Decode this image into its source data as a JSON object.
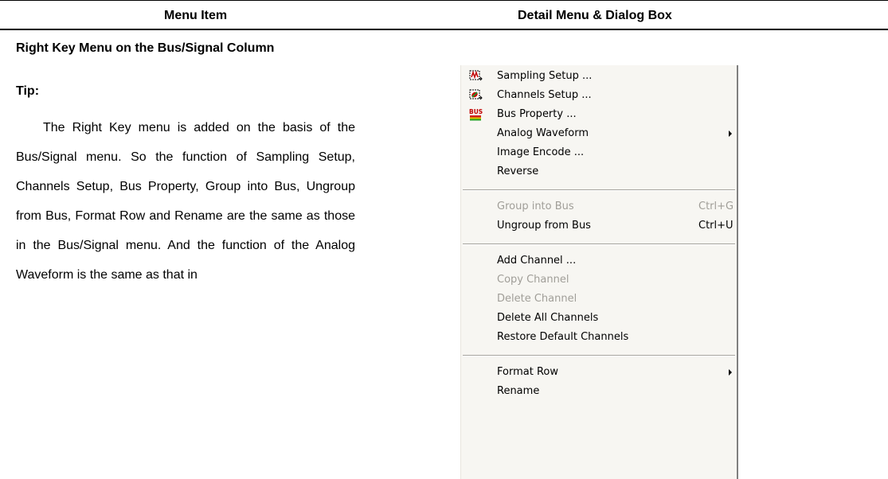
{
  "table": {
    "headers": [
      "Menu Item",
      "Detail Menu & Dialog Box"
    ]
  },
  "left": {
    "section_title": "Right Key Menu on the Bus/Signal Column",
    "tip_title": "Tip:",
    "tip_body": "The Right Key menu is added on the basis of the Bus/Signal menu. So the function of Sampling Setup, Channels Setup, Bus Property, Group into Bus, Ungroup from Bus, Format Row and Rename are the same as those in the Bus/Signal menu. And the function of the Analog Waveform is the same as that in"
  },
  "menu": {
    "items": [
      {
        "label": "Sampling Setup ...",
        "icon": "sampling-setup-icon",
        "enabled": true
      },
      {
        "label": "Channels Setup ...",
        "icon": "channels-setup-icon",
        "enabled": true
      },
      {
        "label": "Bus Property ...",
        "icon": "bus-property-icon",
        "icon_text": "BUS",
        "enabled": true
      },
      {
        "label": "Analog Waveform",
        "submenu": true,
        "enabled": true
      },
      {
        "label": "Image Encode ...",
        "enabled": true
      },
      {
        "label": "Reverse",
        "enabled": true
      },
      {
        "label": "Group into Bus",
        "shortcut": "Ctrl+G",
        "enabled": false
      },
      {
        "label": "Ungroup from Bus",
        "shortcut": "Ctrl+U",
        "enabled": true
      },
      {
        "label": "Add Channel ...",
        "enabled": true
      },
      {
        "label": "Copy Channel",
        "enabled": false
      },
      {
        "label": "Delete Channel",
        "enabled": false
      },
      {
        "label": "Delete All Channels",
        "enabled": true
      },
      {
        "label": "Restore Default Channels",
        "enabled": true
      },
      {
        "label": "Format Row",
        "submenu": true,
        "enabled": true
      },
      {
        "label": "Rename",
        "enabled": true
      }
    ],
    "colors": {
      "background": "#f7f6f2",
      "disabled_text": "#a09e98",
      "border": "#808080"
    }
  }
}
